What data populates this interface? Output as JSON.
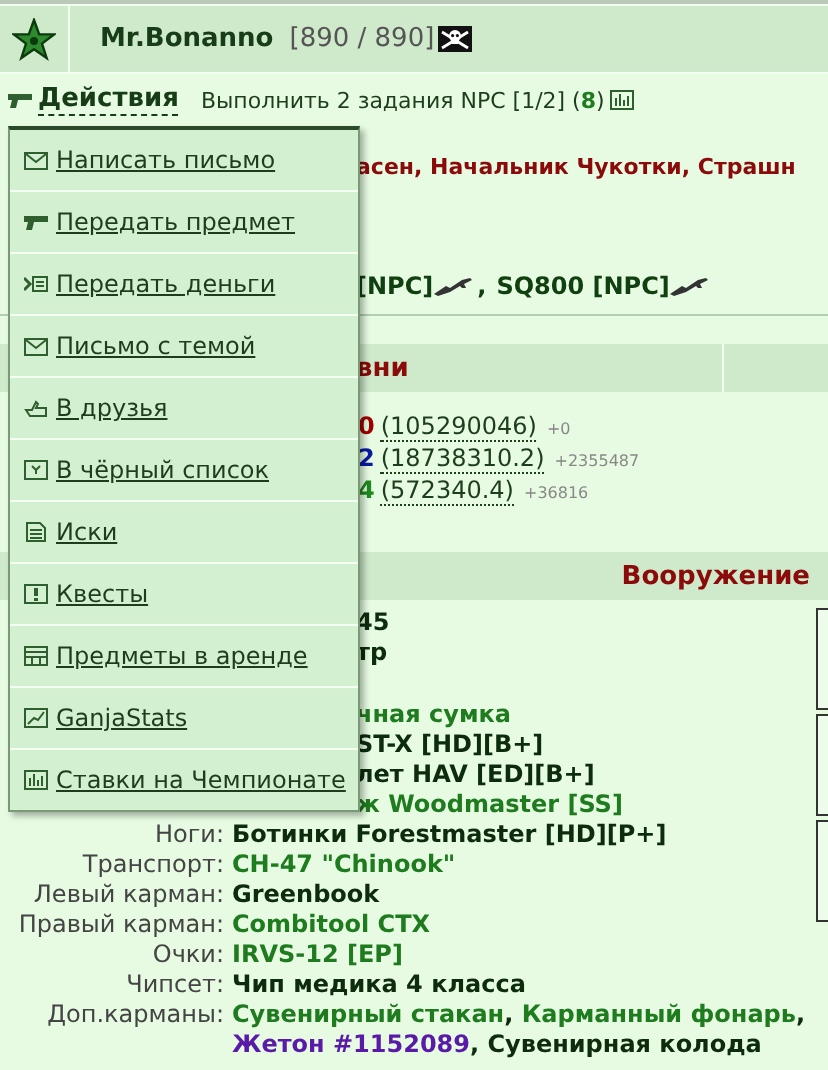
{
  "header": {
    "name": "Mr.Bonanno",
    "hp": "[890 / 890]"
  },
  "actions": {
    "label": "Действия",
    "quest": "Выполнить 2 задания NPC [1/2] (**8**)"
  },
  "menu": [
    {
      "label": "Написать письмо",
      "kind": "envelope"
    },
    {
      "label": "Передать предмет",
      "kind": "pistol"
    },
    {
      "label": "Передать деньги",
      "kind": "money"
    },
    {
      "label": "Письмо с темой",
      "kind": "envelope"
    },
    {
      "label": "В друзья",
      "kind": "hand"
    },
    {
      "label": "В чёрный список",
      "kind": "blacklist"
    },
    {
      "label": "Иски",
      "kind": "document"
    },
    {
      "label": "Квесты",
      "kind": "exclamation"
    },
    {
      "label": "Предметы в аренде",
      "kind": "table"
    },
    {
      "label": "GanjaStats",
      "kind": "linechart"
    },
    {
      "label": "Ставки на Чемпионате",
      "kind": "barchart"
    }
  ],
  "titles_line": "асен, Начальник Чукотки, Страшн",
  "npc_line": {
    "parts": [
      "[NPC]",
      "SQ800 [NPC]"
    ],
    "separator": ","
  },
  "levels": {
    "title": "вни",
    "rows": [
      {
        "value": "0",
        "color": "#a00000",
        "exp": "(105290046)",
        "delta": "+0"
      },
      {
        "value": "2",
        "color": "#0a1aa0",
        "exp": "(18738310.2)",
        "delta": "+2355487"
      },
      {
        "value": "4",
        "color": "#1e8a1e",
        "exp": "(572340.4)",
        "delta": "+36816"
      }
    ]
  },
  "equipment": {
    "title": "Вооружение",
    "groups": [
      [
        {
          "value": "45",
          "color": "#0d2b0d"
        },
        {
          "value": "тр",
          "color": "#0d2b0d"
        }
      ],
      [
        {
          "value": "чная сумка",
          "color": "#1e7b1e"
        },
        {
          "value": "ST-X [HD][B+]",
          "color": "#0d2b0d"
        },
        {
          "value": "лет HAV [ED][B+]",
          "color": "#0d2b0d"
        },
        {
          "value": "ж Woodmaster [SS]",
          "color": "#1e7b1e"
        },
        {
          "label": "Ноги:",
          "value": "Ботинки Forestmaster [HD][P+]",
          "color": "#0d2b0d"
        },
        {
          "label": "Транспорт:",
          "value": "CH-47 \"Chinook\"",
          "color": "#1e7b1e"
        },
        {
          "label": "Левый карман:",
          "value": "Greenbook",
          "color": "#0d2b0d"
        },
        {
          "label": "Правый карман:",
          "value": "Combitool CTX",
          "color": "#1e7b1e"
        },
        {
          "label": "Очки:",
          "value": "IRVS-12 [EP]",
          "color": "#1e7b1e"
        },
        {
          "label": "Чипсет:",
          "value": "Чип медика 4 класса",
          "color": "#0d2b0d"
        },
        {
          "label": "Доп.карманы:",
          "parts": [
            {
              "text": "Сувенирный стакан",
              "color": "#1e7b1e"
            },
            {
              "text": "Карманный фонарь",
              "color": "#1e7b1e"
            },
            {
              "text": "Жетон #1152089",
              "color": "#5a1aa8"
            },
            {
              "text": "Сувенирная колода",
              "color": "#0d2b0d"
            }
          ],
          "separator": ","
        }
      ]
    ]
  }
}
